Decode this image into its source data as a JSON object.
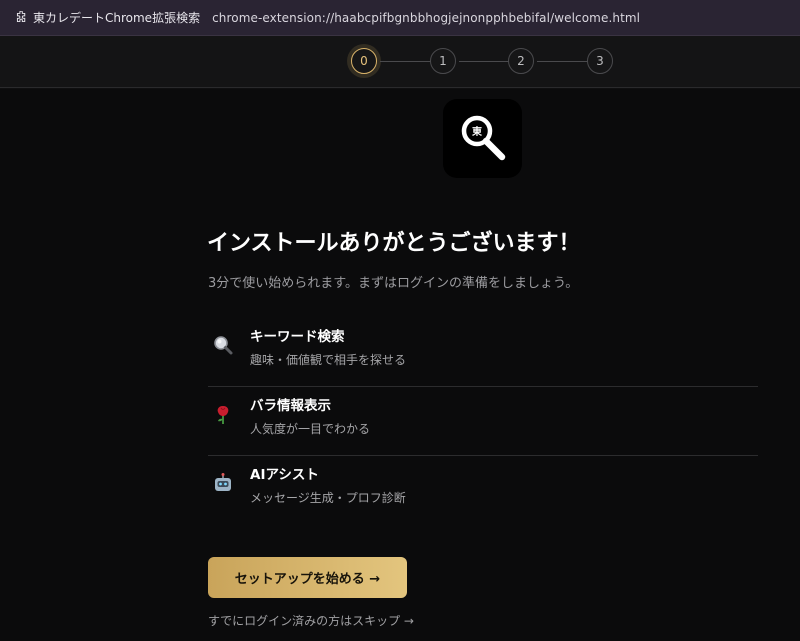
{
  "browser": {
    "extension_name": "東カレデートChrome拡張検索",
    "url": "chrome-extension://haabcpifbgnbbhogjejnonpphbebifal/welcome.html",
    "extension_icon": "puzzle-icon"
  },
  "stepper": {
    "steps": [
      "0",
      "1",
      "2",
      "3"
    ],
    "current_step": 0,
    "accent_color": "#d9b36a"
  },
  "app_icon": {
    "icon": "magnifier-icon",
    "glyph": "東"
  },
  "welcome": {
    "title": "インストールありがとうございます！",
    "subtitle": "3分で使い始められます。まずはログインの準備をしましょう。"
  },
  "features": [
    {
      "icon": "magnifying-glass-icon",
      "title": "キーワード検索",
      "description": "趣味・価値観で相手を探せる"
    },
    {
      "icon": "rose-icon",
      "title": "バラ情報表示",
      "description": "人気度が一目でわかる"
    },
    {
      "icon": "robot-icon",
      "title": "AIアシスト",
      "description": "メッセージ生成・プロフ診断"
    }
  ],
  "actions": {
    "primary_label": "セットアップを始める →",
    "skip_label": "すでにログイン済みの方はスキップ →"
  },
  "colors": {
    "background": "#0b0b0c",
    "button_gradient_start": "#c9a45a",
    "button_gradient_end": "#e3c57e"
  }
}
